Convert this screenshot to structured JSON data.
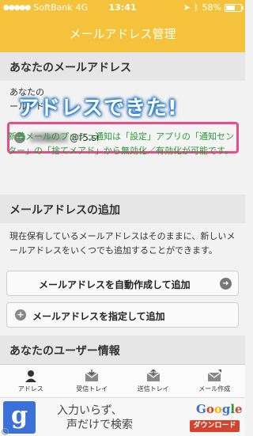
{
  "status": {
    "carrier": "SoftBank",
    "network": "4G",
    "time": "13:41",
    "battery": "58%"
  },
  "nav": {
    "title": "メールアドレス管理"
  },
  "sections": {
    "my_address": {
      "title": "あなたのメールアドレス",
      "line1": "あなたの",
      "line2": "ールアドレ",
      "address_domain": "@f5.si",
      "push_note": "新着メールのプッシュ通知は「設定」アプリの「通知センター」の「捨てメアド」から無効化／有効化が可能です。"
    },
    "add_address": {
      "title": "メールアドレスの追加",
      "desc": "現在保有しているメールアドレスはそのままに、新しいメールアドレスをいくつでも追加することができます。",
      "auto_button": "メールアドレスを自動作成して追加",
      "specify_button": "メールアドレスを指定して追加"
    },
    "user_info": {
      "title": "あなたのユーザー情報"
    }
  },
  "callout": "アドレスできた!",
  "tabs": [
    {
      "label": "アドレス",
      "icon": "person-icon"
    },
    {
      "label": "受信トレイ",
      "icon": "inbox-icon"
    },
    {
      "label": "送信トレイ",
      "icon": "outbox-icon"
    },
    {
      "label": "メール作成",
      "icon": "compose-icon"
    }
  ],
  "ad": {
    "line1": "入力いらず、",
    "line2": "声だけで検索",
    "brand": "Google",
    "download": "ダウンロード",
    "logo_letter": "g"
  },
  "colors": {
    "accent": "#f4c33b",
    "highlight": "#e84d8a",
    "green": "#2a9a36"
  }
}
